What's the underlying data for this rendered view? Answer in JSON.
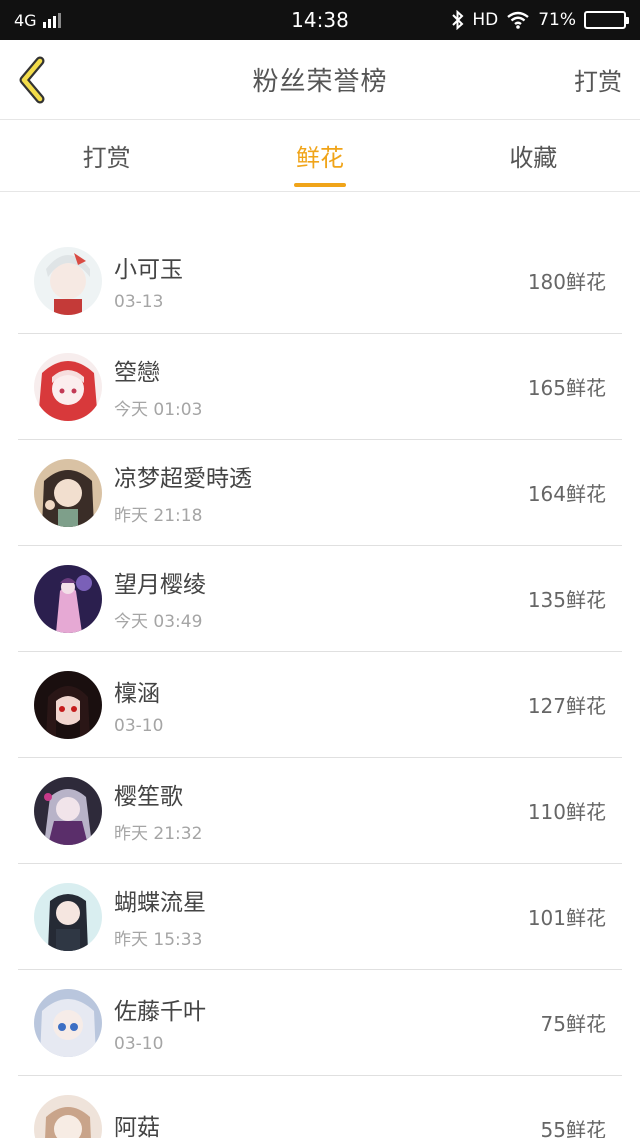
{
  "status_bar": {
    "network": "4G",
    "time": "14:38",
    "hd": "HD",
    "battery": "71%",
    "battery_level": 0.71
  },
  "nav": {
    "back_icon": "chevron-left-icon",
    "title": "粉丝荣誉榜",
    "right_action": "打赏"
  },
  "tabs": [
    {
      "label": "打赏",
      "active": false
    },
    {
      "label": "鲜花",
      "active": true
    },
    {
      "label": "收藏",
      "active": false
    }
  ],
  "colors": {
    "accent": "#f0a419",
    "text": "#444444",
    "subtext": "#a5a5a5"
  },
  "fans": [
    {
      "name": "小可玉",
      "time": "03-13",
      "count": "180鲜花"
    },
    {
      "name": "箜戀",
      "time": "今天 01:03",
      "count": "165鲜花"
    },
    {
      "name": "凉梦超愛時透",
      "time": "昨天 21:18",
      "count": "164鲜花"
    },
    {
      "name": "望月樱绫",
      "time": "今天 03:49",
      "count": "135鲜花"
    },
    {
      "name": "檁涵",
      "time": "03-10",
      "count": "127鲜花"
    },
    {
      "name": "樱笙歌",
      "time": "昨天 21:32",
      "count": "110鲜花"
    },
    {
      "name": "蝴蝶流星",
      "time": "昨天 15:33",
      "count": "101鲜花"
    },
    {
      "name": "佐藤千叶",
      "time": "03-10",
      "count": "75鲜花"
    },
    {
      "name": "阿菇",
      "time": "",
      "count": "55鲜花"
    }
  ]
}
